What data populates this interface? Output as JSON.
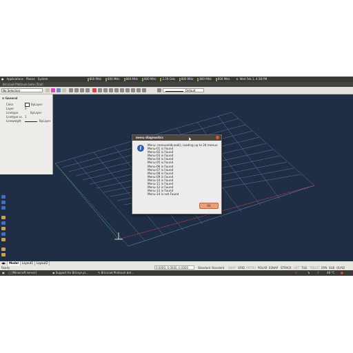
{
  "topbar": {
    "menus": [
      "Applications",
      "Places",
      "System"
    ],
    "cpu_labels": [
      "800 MHz",
      "800 MHz",
      "800 MHz",
      "800 MHz",
      "2.29 GHz",
      "800 MHz",
      "800 MHz",
      "800 MHz"
    ],
    "clock": "Wed Feb 1, 4:38 PM"
  },
  "window": {
    "title": "Bricscad Platinum beta (Trial)"
  },
  "toolbar": {
    "selection": "No Selection",
    "lineweight": "Default"
  },
  "properties": {
    "header": "General",
    "rows": [
      {
        "label": "Color",
        "value": "ByLayer"
      },
      {
        "label": "Layer",
        "value": "0"
      },
      {
        "label": "Linetype",
        "value": "ByLayer"
      },
      {
        "label": "Linetype sc.",
        "value": "1"
      },
      {
        "label": "Lineweight",
        "value": "ByLayer"
      }
    ]
  },
  "tabs": [
    "Model",
    "Layout1",
    "Layout2"
  ],
  "status": {
    "left": "Ready",
    "coords": "0.0000, 0.0000, 0.0000",
    "items": [
      "Standard",
      "Standard",
      "SNAP",
      "GRID",
      "ORTHO",
      "POLAR",
      "ESNAP",
      "STRACK",
      "LWT",
      "TILE",
      "TABLET",
      "DYN",
      "SUB",
      "QUAD"
    ]
  },
  "taskbar": {
    "tasks": [
      "[Minecraft server]",
      "Support for Bricsys pr...",
      "Bricscad Platinum bet..."
    ],
    "temp": "48 °C"
  },
  "dialog": {
    "title": "menu diagnostics",
    "lines": [
      "Menu: menuonIdLoad(), loading up to 24 menus:",
      "Menu-01 is Found",
      "Menu-02 is Found",
      "Menu-03 is Found",
      "Menu-04 is Found",
      "Menu-05 is Found",
      "Menu-06 is Found",
      "Menu-07 is Found",
      "Menu-08 is Found",
      "Menu-09 is Found",
      "Menu-10 is Found",
      "Menu-11 is Found",
      "Menu-12 is Found",
      "Menu-13 is Found",
      "Menu-14 is not Found"
    ],
    "ok_label": "OK"
  }
}
